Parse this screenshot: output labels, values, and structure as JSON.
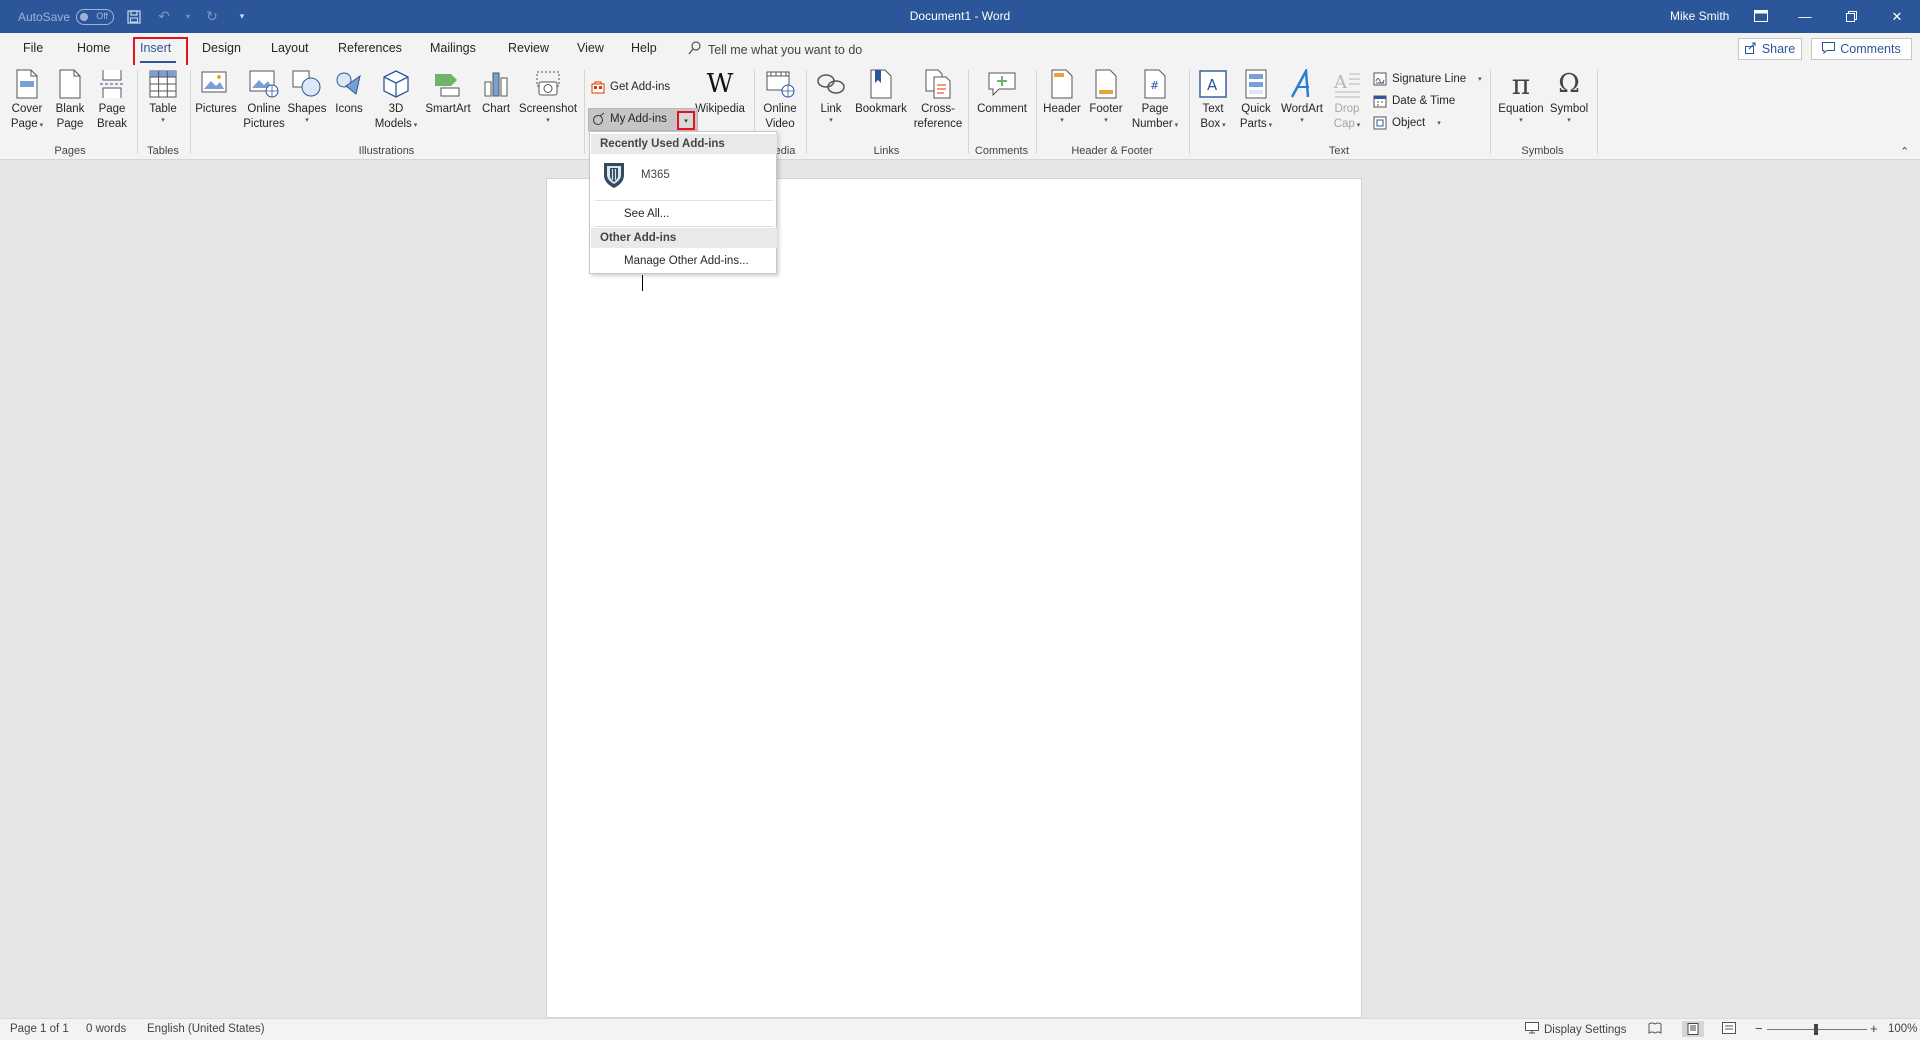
{
  "titlebar": {
    "autosave_label": "AutoSave",
    "autosave_state": "Off",
    "document_title": "Document1 - Word",
    "user_name": "Mike Smith",
    "brand_color": "#2b579a"
  },
  "tabs": {
    "file": "File",
    "home": "Home",
    "insert": "Insert",
    "design": "Design",
    "layout": "Layout",
    "references": "References",
    "mailings": "Mailings",
    "review": "Review",
    "view": "View",
    "help": "Help",
    "tell_me": "Tell me what you want to do",
    "share": "Share",
    "comments": "Comments"
  },
  "ribbon": {
    "pages": {
      "label": "Pages",
      "cover_page": [
        "Cover",
        "Page"
      ],
      "blank_page": [
        "Blank",
        "Page"
      ],
      "page_break": [
        "Page",
        "Break"
      ]
    },
    "tables": {
      "label": "Tables",
      "table": "Table"
    },
    "illustrations": {
      "label": "Illustrations",
      "pictures": "Pictures",
      "online_pictures": [
        "Online",
        "Pictures"
      ],
      "shapes": "Shapes",
      "icons": "Icons",
      "models_3d": [
        "3D",
        "Models"
      ],
      "smartart": "SmartArt",
      "chart": "Chart",
      "screenshot": "Screenshot"
    },
    "addins": {
      "get_addins": "Get Add-ins",
      "my_addins": "My Add-ins",
      "wikipedia": "Wikipedia"
    },
    "media": {
      "label_fragment": "edia",
      "online_video": [
        "Online",
        "Video"
      ]
    },
    "links": {
      "label": "Links",
      "link": "Link",
      "bookmark": "Bookmark",
      "cross_reference": [
        "Cross-",
        "reference"
      ]
    },
    "comments": {
      "label": "Comments",
      "comment": "Comment"
    },
    "header_footer": {
      "label": "Header & Footer",
      "header": "Header",
      "footer": "Footer",
      "page_number": [
        "Page",
        "Number"
      ]
    },
    "text": {
      "label": "Text",
      "text_box": [
        "Text",
        "Box"
      ],
      "quick_parts": [
        "Quick",
        "Parts"
      ],
      "wordart": "WordArt",
      "drop_cap": [
        "Drop",
        "Cap"
      ],
      "signature_line": "Signature Line",
      "date_time": "Date & Time",
      "object": "Object"
    },
    "symbols": {
      "label": "Symbols",
      "equation": "Equation",
      "symbol": "Symbol"
    }
  },
  "dropdown": {
    "recently_used_header": "Recently Used Add-ins",
    "recent_addin": "M365",
    "see_all": "See All...",
    "other_header": "Other Add-ins",
    "manage": "Manage Other Add-ins..."
  },
  "statusbar": {
    "page": "Page 1 of 1",
    "words": "0 words",
    "language": "English (United States)",
    "display_settings": "Display Settings",
    "zoom": "100%"
  },
  "colors": {
    "highlight": "#e81123",
    "accent": "#2b579a"
  }
}
